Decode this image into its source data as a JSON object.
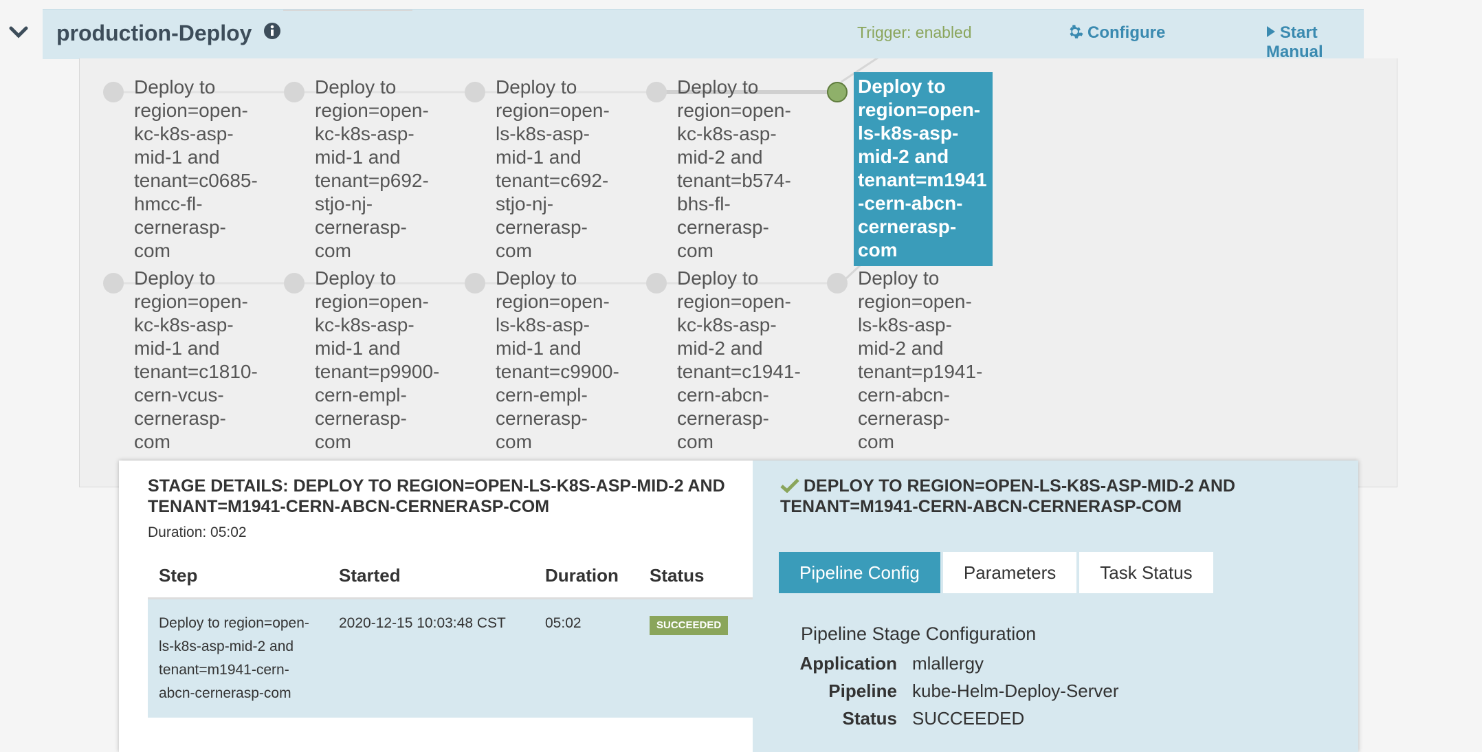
{
  "header": {
    "pipeline_name": "production-Deploy",
    "trigger": "Trigger: enabled",
    "configure": "Configure",
    "start": "Start Manual Execution"
  },
  "stages": {
    "row1": [
      "Deploy to region=open-kc-k8s-asp-mid-1 and tenant=c0685-hmcc-fl-cernerasp-com",
      "Deploy to region=open-kc-k8s-asp-mid-1 and tenant=p692-stjo-nj-cernerasp-com",
      "Deploy to region=open-ls-k8s-asp-mid-1 and tenant=c692-stjo-nj-cernerasp-com",
      "Deploy to region=open-kc-k8s-asp-mid-2 and tenant=b574-bhs-fl-cernerasp-com",
      "Deploy to region=open-ls-k8s-asp-mid-2 and tenant=m1941-cern-abcn-cernerasp-com"
    ],
    "row2": [
      "Deploy to region=open-kc-k8s-asp-mid-1 and tenant=c1810-cern-vcus-cernerasp-com",
      "Deploy to region=open-kc-k8s-asp-mid-1 and tenant=p9900-cern-empl-cernerasp-com",
      "Deploy to region=open-ls-k8s-asp-mid-1 and tenant=c9900-cern-empl-cernerasp-com",
      "Deploy to region=open-kc-k8s-asp-mid-2 and tenant=c1941-cern-abcn-cernerasp-com",
      "Deploy to region=open-ls-k8s-asp-mid-2 and tenant=p1941-cern-abcn-cernerasp-com"
    ]
  },
  "details": {
    "title": "STAGE DETAILS: DEPLOY TO REGION=OPEN-LS-K8S-ASP-MID-2 AND TENANT=M1941-CERN-ABCN-CERNERASP-COM",
    "duration": "Duration: 05:02",
    "columns": [
      "Step",
      "Started",
      "Duration",
      "Status"
    ],
    "step": {
      "name": "Deploy to region=open-ls-k8s-asp-mid-2 and tenant=m1941-cern-abcn-cernerasp-com",
      "started": "2020-12-15 10:03:48 CST",
      "duration": "05:02",
      "status": "SUCCEEDED"
    }
  },
  "right": {
    "title": "DEPLOY TO REGION=OPEN-LS-K8S-ASP-MID-2 AND TENANT=M1941-CERN-ABCN-CERNERASP-COM",
    "tabs": [
      "Pipeline Config",
      "Parameters",
      "Task Status"
    ],
    "config_title": "Pipeline Stage Configuration",
    "fields": [
      {
        "k": "Application",
        "v": "mlallergy"
      },
      {
        "k": "Pipeline",
        "v": "kube-Helm-Deploy-Server"
      },
      {
        "k": "Status",
        "v": "SUCCEEDED"
      }
    ]
  },
  "colors": {
    "accent": "#3a9cba",
    "success": "#8aa55b",
    "panel": "#d7e8ef"
  }
}
